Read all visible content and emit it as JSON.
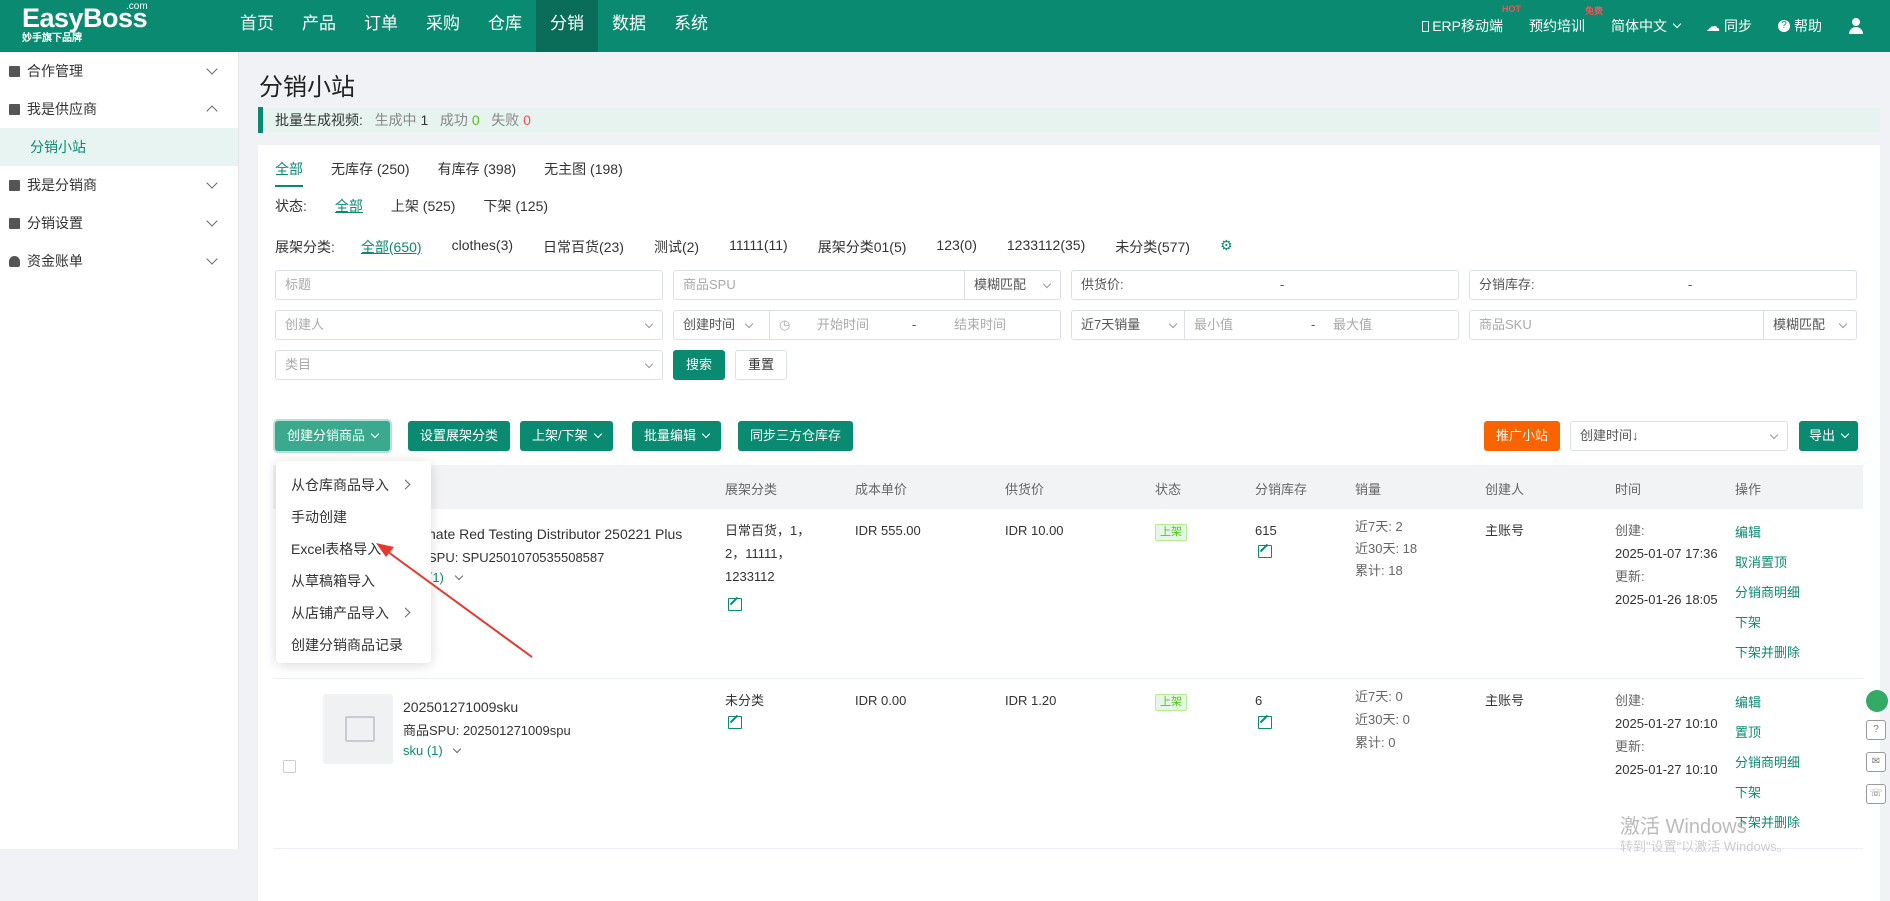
{
  "app": {
    "logo": "EasyBoss",
    "logo_com": ".com",
    "logo_sub": "妙手旗下品牌"
  },
  "nav": [
    "首页",
    "产品",
    "订单",
    "采购",
    "仓库",
    "分销",
    "数据",
    "系统"
  ],
  "nav_active": "分销",
  "top_right": {
    "erp": "ERP移动端",
    "erp_badge": "HOT",
    "training": "预约培训",
    "training_badge": "免费",
    "lang": "简体中文",
    "sync": "同步",
    "help": "帮助"
  },
  "sidebar": {
    "items": [
      {
        "label": "合作管理"
      },
      {
        "label": "我是供应商"
      },
      {
        "label": "分销小站"
      },
      {
        "label": "我是分销商"
      },
      {
        "label": "分销设置"
      },
      {
        "label": "资金账单"
      }
    ]
  },
  "page": {
    "title": "分销小站"
  },
  "banner": {
    "label": "批量生成视频:",
    "gen_label": "生成中",
    "gen_count": "1",
    "ok_label": "成功",
    "ok_count": "0",
    "fail_label": "失败",
    "fail_count": "0"
  },
  "tabs": [
    "全部",
    "无库存 (250)",
    "有库存 (398)",
    "无主图 (198)"
  ],
  "status": {
    "label": "状态:",
    "options": [
      "全部",
      "上架 (525)",
      "下架 (125)"
    ]
  },
  "category": {
    "label": "展架分类:",
    "options": [
      "全部(650)",
      "clothes(3)",
      "日常百货(23)",
      "测试(2)",
      "11111(11)",
      "展架分类01(5)",
      "123(0)",
      "1233112(35)",
      "未分类(577)"
    ]
  },
  "filters": {
    "title_ph": "标题",
    "spu_ph": "商品SPU",
    "fuzzy": "模糊匹配",
    "supply_price": "供货价:",
    "dist_stock": "分销库存:",
    "creator_ph": "创建人",
    "create_time": "创建时间",
    "start_time": "开始时间",
    "end_time": "结束时间",
    "sales7": "近7天销量",
    "min": "最小值",
    "max": "最大值",
    "sku_ph": "商品SKU",
    "category_ph": "类目",
    "dash": "-",
    "search": "搜索",
    "reset": "重置"
  },
  "toolbar": {
    "create": "创建分销商品",
    "set_cat": "设置展架分类",
    "onoff": "上架/下架",
    "batch_edit": "批量编辑",
    "sync": "同步三方仓库存",
    "promote": "推广小站",
    "sort": "创建时间↓",
    "export": "导出"
  },
  "table": {
    "headers": [
      "展架分类",
      "成本单价",
      "供货价",
      "状态",
      "分销库存",
      "销量",
      "创建人",
      "时间",
      "操作"
    ],
    "rows": [
      {
        "title": "nate Red Testing Distributor 250221 Plus",
        "spu": "SPU:  SPU2501070535508587",
        "sku": "(1)",
        "category": "日常百货，1，2，11111，1233112",
        "cost": "IDR 555.00",
        "price": "IDR 10.00",
        "status": "上架",
        "stock": "615",
        "s7": "近7天:  2",
        "s30": "近30天:  18",
        "stotal": "累计:  18",
        "creator": "主账号",
        "created_label": "创建:",
        "created": "2025-01-07 17:36",
        "updated_label": "更新:",
        "updated": "2025-01-26 18:05",
        "ops": [
          "编辑",
          "取消置顶",
          "分销商明细",
          "下架",
          "下架并删除"
        ]
      },
      {
        "title": "202501271009sku",
        "spu": "商品SPU:  202501271009spu",
        "sku": "sku (1)",
        "category": "未分类",
        "cost": "IDR 0.00",
        "price": "IDR 1.20",
        "status": "上架",
        "stock": "6",
        "s7": "近7天:  0",
        "s30": "近30天:  0",
        "stotal": "累计:  0",
        "creator": "主账号",
        "created_label": "创建:",
        "created": "2025-01-27 10:10",
        "updated_label": "更新:",
        "updated": "2025-01-27 10:10",
        "ops": [
          "编辑",
          "置顶",
          "分销商明细",
          "下架",
          "下架并删除"
        ]
      }
    ]
  },
  "dropdown": [
    "从仓库商品导入",
    "手动创建",
    "Excel表格导入",
    "从草稿箱导入",
    "从店铺产品导入",
    "创建分销商品记录"
  ],
  "watermark": {
    "line1": "激活 Windows",
    "line2": "转到\"设置\"以激活 Windows。"
  },
  "colors": {
    "primary": "#0b8a72",
    "orange": "#fa6400",
    "arrow": "#e8372c"
  }
}
